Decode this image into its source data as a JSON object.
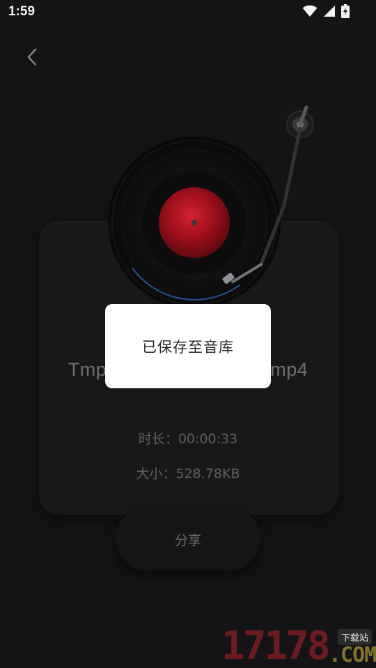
{
  "status_bar": {
    "time": "1:59",
    "icons": [
      "wifi-icon",
      "cellular-signal-icon",
      "battery-charging-icon"
    ]
  },
  "nav": {
    "back_icon": "chevron-left-icon"
  },
  "record": {
    "label_color": "#b3121e",
    "accent_color": "#3b6fd6"
  },
  "file_info": {
    "name_left": "Tmp",
    "name_right": "mp4",
    "duration_label": "时长：00:00:33",
    "size_label": "大小：528.78KB"
  },
  "actions": {
    "share_label": "分享"
  },
  "toast": {
    "message": "已保存至音库"
  },
  "watermark": {
    "digits": "17178",
    "sub": "下载站",
    "domain": ".COM"
  }
}
